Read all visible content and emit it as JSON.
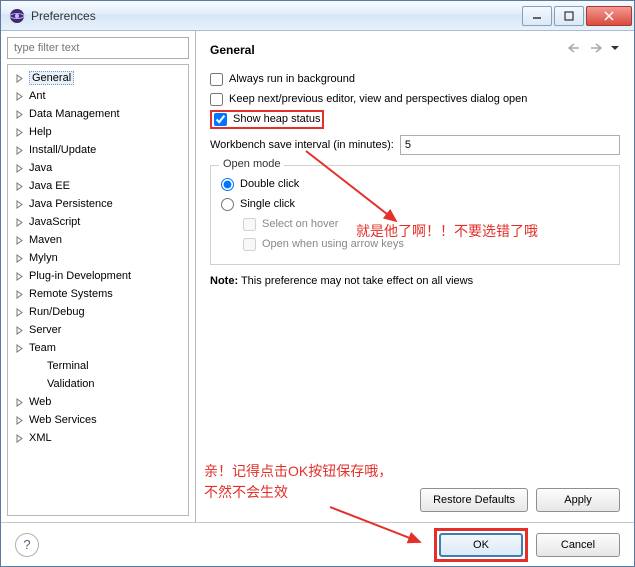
{
  "window": {
    "title": "Preferences"
  },
  "filter": {
    "placeholder": "type filter text"
  },
  "tree": [
    {
      "label": "General",
      "sel": true,
      "exp": true
    },
    {
      "label": "Ant"
    },
    {
      "label": "Data Management"
    },
    {
      "label": "Help"
    },
    {
      "label": "Install/Update"
    },
    {
      "label": "Java"
    },
    {
      "label": "Java EE"
    },
    {
      "label": "Java Persistence"
    },
    {
      "label": "JavaScript"
    },
    {
      "label": "Maven"
    },
    {
      "label": "Mylyn"
    },
    {
      "label": "Plug-in Development"
    },
    {
      "label": "Remote Systems"
    },
    {
      "label": "Run/Debug"
    },
    {
      "label": "Server"
    },
    {
      "label": "Team"
    },
    {
      "label": "Terminal",
      "child": true
    },
    {
      "label": "Validation",
      "child": true
    },
    {
      "label": "Web"
    },
    {
      "label": "Web Services"
    },
    {
      "label": "XML"
    }
  ],
  "page": {
    "title": "General",
    "cb1": "Always run in background",
    "cb2": "Keep next/previous editor, view and perspectives dialog open",
    "cb3": "Show heap status",
    "saveLabel": "Workbench save interval (in minutes):",
    "saveValue": "5",
    "group": {
      "title": "Open mode",
      "r1": "Double click",
      "r2": "Single click",
      "s1": "Select on hover",
      "s2": "Open when using arrow keys"
    },
    "noteBold": "Note:",
    "noteText": " This preference may not take effect on all views"
  },
  "buttons": {
    "restore": "Restore Defaults",
    "apply": "Apply",
    "ok": "OK",
    "cancel": "Cancel"
  },
  "annotations": {
    "a1": "就是他了啊！！不要选错了哦",
    "a2": "亲！记得点击OK按钮保存哦，不然不会生效"
  }
}
